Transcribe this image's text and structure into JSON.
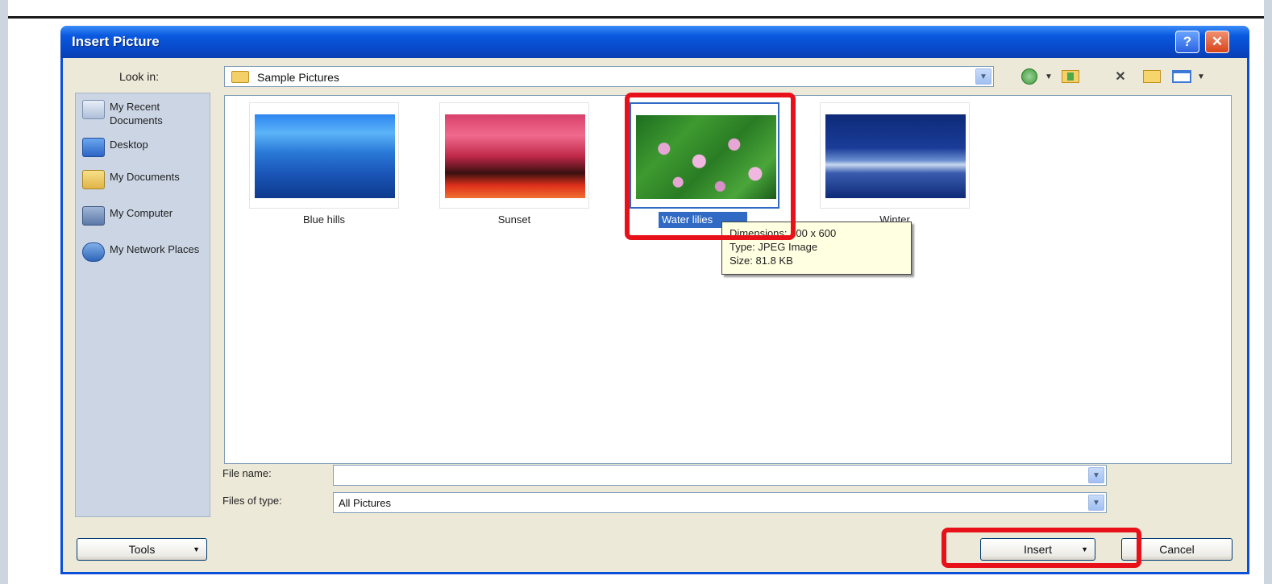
{
  "dialog": {
    "title": "Insert Picture",
    "help_button": "?",
    "close_button": "✕"
  },
  "look_in": {
    "label": "Look in:",
    "value": "Sample Pictures"
  },
  "toolbar": {
    "icons": [
      "back-icon",
      "up-folder-icon",
      "delete-icon",
      "new-folder-icon",
      "views-icon"
    ]
  },
  "places": [
    {
      "label": "My Recent Documents",
      "icon": "recent-documents-icon"
    },
    {
      "label": "Desktop",
      "icon": "desktop-icon"
    },
    {
      "label": "My Documents",
      "icon": "my-documents-icon"
    },
    {
      "label": "My Computer",
      "icon": "my-computer-icon"
    },
    {
      "label": "My Network Places",
      "icon": "network-places-icon"
    }
  ],
  "files": [
    {
      "name": "Blue hills"
    },
    {
      "name": "Sunset"
    },
    {
      "name": "Water lilies"
    },
    {
      "name": "Winter"
    }
  ],
  "tooltip": {
    "dimensions": "Dimensions: 800 x 600",
    "type": "Type: JPEG Image",
    "size": "Size: 81.8 KB"
  },
  "file_name": {
    "label": "File name:",
    "value": ""
  },
  "files_of_type": {
    "label": "Files of type:",
    "value": "All Pictures"
  },
  "buttons": {
    "tools": "Tools",
    "insert": "Insert",
    "cancel": "Cancel"
  },
  "colors": {
    "titlebar": "#0a5ae0",
    "highlight": "#e8111a",
    "selection": "#316ac5"
  }
}
